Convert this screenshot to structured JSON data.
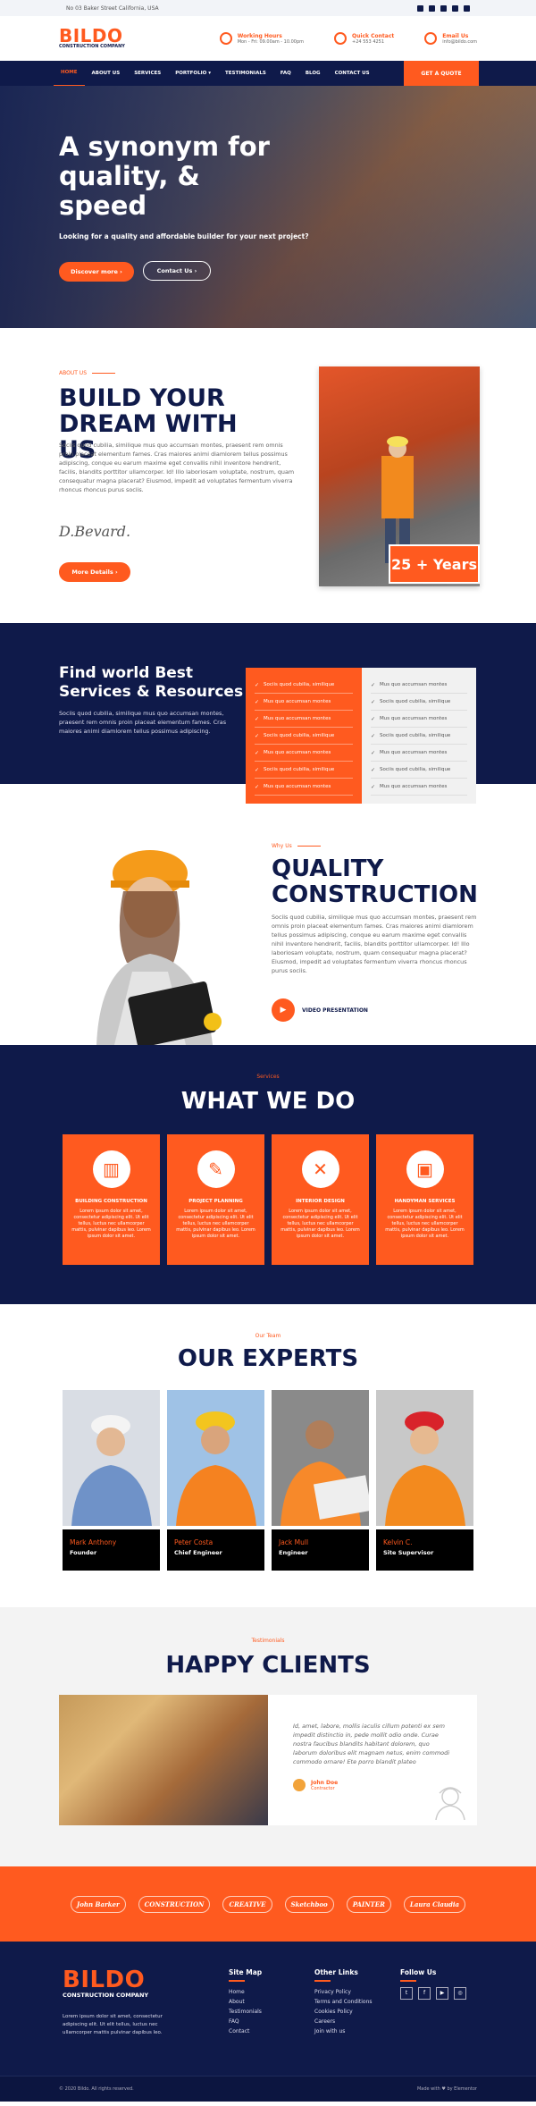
{
  "topbar": {
    "address": "No 03 Baker Street California, USA"
  },
  "logo": {
    "main": "BILDO",
    "sub": "CONSTRUCTION COMPANY"
  },
  "contacts": [
    {
      "title": "Working Hours",
      "value": "Mon - Fri: 09.00am - 10.00pm"
    },
    {
      "title": "Quick Contact",
      "value": "+24 553 4251"
    },
    {
      "title": "Email Us",
      "value": "info@bildo.com"
    }
  ],
  "nav": [
    "HOME",
    "ABOUT US",
    "SERVICES",
    "PORTFOLIO ▾",
    "TESTIMONIALS",
    "FAQ",
    "BLOG",
    "CONTACT US"
  ],
  "nav_cta": "GET A QUOTE",
  "hero": {
    "title": "A synonym for quality, & speed",
    "subtitle": "Looking for a quality and affordable builder for your next project?",
    "btn1": "Discover more  ›",
    "btn2": "Contact Us  ›"
  },
  "about": {
    "eyebrow": "ABOUT US",
    "title": "BUILD YOUR DREAM WITH US",
    "text": "Sociis quod cubilia, similique mus quo accumsan montes, praesent rem omnis proin placeat elementum fames. Cras maiores animi diamlorem tellus possimus adipiscing, conque eu earum maxime eget convallis nihil inventore hendrerit, facilis, blandits porttitor ullamcorper. Id! Illo laboriosam voluptate, nostrum, quam consequatur magna placerat? Eiusmod, impedit ad voluptates fermentum viverra rhoncus rhoncus purus sociis.",
    "signature": "D.Bevard.",
    "btn": "More Details  ›",
    "years": "25 + Years"
  },
  "find": {
    "title": "Find world Best Services & Resources",
    "text": "Sociis quod cubilia, similique mus quo accumsan montes, praesent rem omnis proin placeat elementum fames. Cras maiores animi diamlorem tellus possimus adipiscing.",
    "orange_list": [
      "Sociis quod cubilia, similique",
      "Mus quo accumsan montes",
      "Mus quo accumsan montes",
      "Sociis quod cubilia, similique",
      "Mus quo accumsan montes",
      "Sociis quod cubilia, similique",
      "Mus quo accumsan montes"
    ],
    "grey_list": [
      "Mus quo accumsan montes",
      "Sociis quod cubilia, similique",
      "Mus quo accumsan montes",
      "Sociis quod cubilia, similique",
      "Mus quo accumsan montes",
      "Sociis quod cubilia, similique",
      "Mus quo accumsan montes"
    ]
  },
  "quality": {
    "eyebrow": "Why Us",
    "title": "QUALITY CONSTRUCTION",
    "text": "Sociis quod cubilia, similique mus quo accumsan montes, praesent rem omnis proin placeat elementum fames. Cras maiores animi diamlorem tellus possimus adipiscing, conque eu earum maxime eget convallis nihil inventore hendrerit, facilis, blandits porttitor ullamcorper. Id! Illo laboriosam voluptate, nostrum, quam consequatur magna placerat? Eiusmod, impedit ad voluptates fermentum viverra rhoncus rhoncus purus sociis.",
    "video": "VIDEO PRESENTATION"
  },
  "services": {
    "eyebrow": "Services",
    "title": "WHAT WE DO",
    "items": [
      {
        "title": "BUILDING CONSTRUCTION",
        "desc": "Lorem ipsum dolor sit amet, consectetur adipiscing elit. Ut elit tellus, luctus nec ullamcorper mattis, pulvinar dapibus leo. Lorem ipsum dolor sit amet."
      },
      {
        "title": "PROJECT PLANNING",
        "desc": "Lorem ipsum dolor sit amet, consectetur adipiscing elit. Ut elit tellus, luctus nec ullamcorper mattis, pulvinar dapibus leo. Lorem ipsum dolor sit amet."
      },
      {
        "title": "INTERIOR DESIGN",
        "desc": "Lorem ipsum dolor sit amet, consectetur adipiscing elit. Ut elit tellus, luctus nec ullamcorper mattis, pulvinar dapibus leo. Lorem ipsum dolor sit amet."
      },
      {
        "title": "HANDYMAN SERVICES",
        "desc": "Lorem ipsum dolor sit amet, consectetur adipiscing elit. Ut elit tellus, luctus nec ullamcorper mattis, pulvinar dapibus leo. Lorem ipsum dolor sit amet."
      }
    ]
  },
  "experts": {
    "eyebrow": "Our Team",
    "title": "OUR EXPERTS",
    "people": [
      {
        "name": "Mark Anthony",
        "role": "Founder"
      },
      {
        "name": "Peter Costa",
        "role": "Chief Engineer"
      },
      {
        "name": "Jack Mull",
        "role": "Engineer"
      },
      {
        "name": "Kelvin C.",
        "role": "Site Supervisor"
      }
    ]
  },
  "clients": {
    "eyebrow": "Testimonials",
    "title": "HAPPY CLIENTS",
    "quote": "Id, amet, labore, mollis iaculis cillum potenti ex sem impedit distinctio in, pede mollit odio onde. Curae nostra faucibus blandits habitant dolorem, quo laborum doloribus elit magnam netus, enim commodi commodo ornare! Ete porro blandit plateo",
    "name": "John Doe",
    "role": "Contractor"
  },
  "brands": [
    "John Barker",
    "CONSTRUCTION",
    "CREATIVE",
    "Sketchboo",
    "PAINTER",
    "Laura Claudia"
  ],
  "footer": {
    "about": "Lorem ipsum dolor sit amet, consectetur adipiscing elit. Ut elit tellus, luctus nec ullamcorper mattis pulvinar dapibus leo.",
    "sitemap_title": "Site Map",
    "sitemap": [
      "Home",
      "About",
      "Testimonials",
      "FAQ",
      "Contact"
    ],
    "other_title": "Other Links",
    "other": [
      "Privacy Policy",
      "Terms and Conditions",
      "Cookies Policy",
      "Careers",
      "Join with us"
    ],
    "follow_title": "Follow Us",
    "copyright": "© 2020 Bildo. All rights reserved.",
    "made": "Made with ♥ by Elementor"
  }
}
